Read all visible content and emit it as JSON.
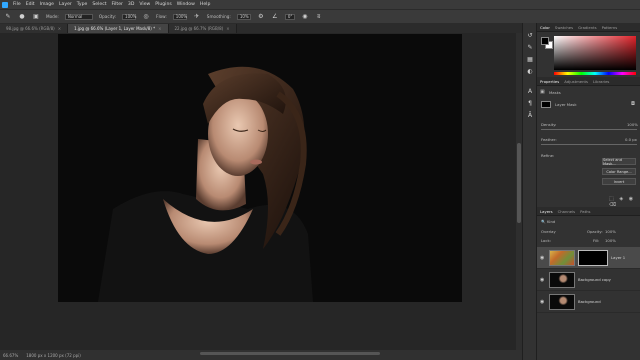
{
  "menu": [
    "Ps",
    "File",
    "Edit",
    "Image",
    "Layer",
    "Type",
    "Select",
    "Filter",
    "3D",
    "View",
    "Plugins",
    "Window",
    "Help"
  ],
  "options": {
    "mode_label": "Mode:",
    "mode_value": "Normal",
    "opacity_label": "Opacity:",
    "opacity_value": "100%",
    "flow_label": "Flow:",
    "flow_value": "100%",
    "smoothing_label": "Smoothing:",
    "smoothing_value": "10%",
    "angle_value": "0°"
  },
  "tabs": [
    {
      "label": "98.jpg @ 66.6% (RGB/8)",
      "active": false
    },
    {
      "label": "1.jpg @ 66.6% (Layer 1, Layer Mask/8) *",
      "active": true
    },
    {
      "label": "22.jpg @ 66.7% (RGB/8)",
      "active": false
    }
  ],
  "status": {
    "zoom": "66.67%",
    "doc": "1800 px x 1200 px (72 ppi)"
  },
  "color_panel": {
    "tabs": [
      "Color",
      "Swatches",
      "Gradients",
      "Patterns"
    ]
  },
  "properties_panel": {
    "tabs": [
      "Properties",
      "Adjustments",
      "Libraries"
    ],
    "section": "Masks",
    "mask_label": "Layer Mask",
    "density_label": "Density:",
    "density_value": "100%",
    "feather_label": "Feather:",
    "feather_value": "0.0 px",
    "refine_label": "Refine:",
    "select_mask_btn": "Select and Mask...",
    "color_range_btn": "Color Range...",
    "invert_btn": "Invert"
  },
  "layers_panel": {
    "tabs": [
      "Layers",
      "Channels",
      "Paths"
    ],
    "kind_label": "Kind",
    "blend_value": "Overlay",
    "opacity_label": "Opacity:",
    "opacity_value": "100%",
    "lock_label": "Lock:",
    "fill_label": "Fill:",
    "fill_value": "100%",
    "layers": [
      {
        "name": "Layer 1",
        "selected": true
      },
      {
        "name": "Background copy",
        "selected": false
      },
      {
        "name": "Background",
        "selected": false
      }
    ]
  }
}
